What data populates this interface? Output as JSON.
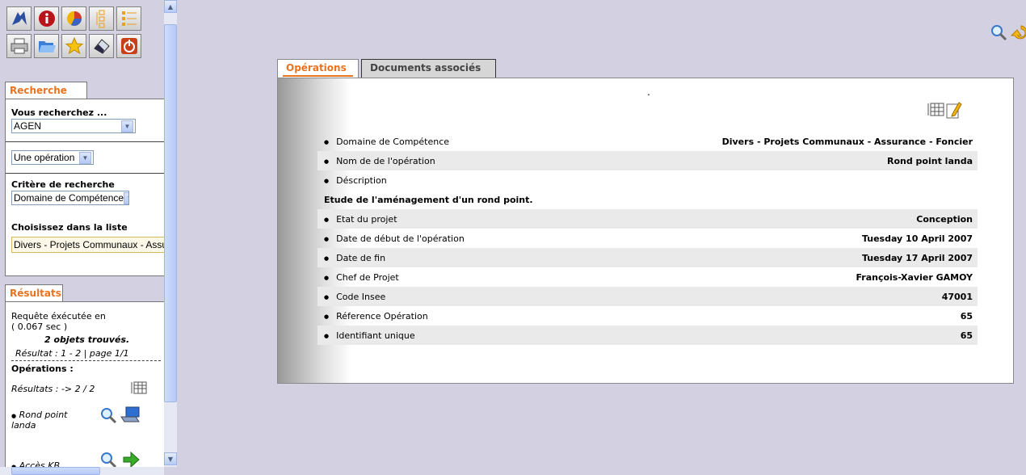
{
  "toolbar": {
    "row1": [
      "navigate-icon",
      "info-icon",
      "chart-icon",
      "tree-icon",
      "list-icon"
    ],
    "row2": [
      "print-icon",
      "open-folder-icon",
      "favorite-star-icon",
      "eraser-icon",
      "power-icon"
    ]
  },
  "search": {
    "tab_label": "Recherche",
    "you_search_label": "Vous recherchez ...",
    "city_value": "AGEN",
    "type_value": "Une opération",
    "criteria_label": "Critère de recherche",
    "criteria_value": "Domaine de Compétence",
    "choose_label": "Choisissez dans la liste",
    "list_value": "Divers - Projets Communaux - Assurance - Foncier"
  },
  "results": {
    "tab_label": "Résultats",
    "query_line1": "Requête éxécutée en",
    "query_line2": "( 0.067 sec )",
    "found": "2 objets trouvés.",
    "range": "Résultat : 1 - 2 | page 1/1",
    "ops_label": "Opérations :",
    "ops_count": "Résultats : -> 2 / 2",
    "items": [
      "Rond point landa",
      "Accès KB"
    ]
  },
  "main": {
    "tabs": [
      "Opérations",
      "Documents associés"
    ],
    "dot": ".",
    "description": "Etude de l'aménagement d'un rond point.",
    "fields": [
      {
        "label": "Domaine de Compétence",
        "value": "Divers - Projets Communaux - Assurance - Foncier"
      },
      {
        "label": "Nom de de l'opération",
        "value": "Rond point landa"
      },
      {
        "label": "Déscription",
        "value": ""
      },
      {
        "label": "Etat du projet",
        "value": "Conception"
      },
      {
        "label": "Date de début de l'opération",
        "value": "Tuesday 10 April 2007"
      },
      {
        "label": "Date de fin",
        "value": "Tuesday 17 April 2007"
      },
      {
        "label": "Chef de Projet",
        "value": "François-Xavier GAMOY"
      },
      {
        "label": "Code Insee",
        "value": "47001"
      },
      {
        "label": "Réference Opération",
        "value": "65"
      },
      {
        "label": "Identifiant unique",
        "value": "65"
      }
    ]
  },
  "colors": {
    "accent": "#e87422",
    "background": "#d3d0e2"
  }
}
